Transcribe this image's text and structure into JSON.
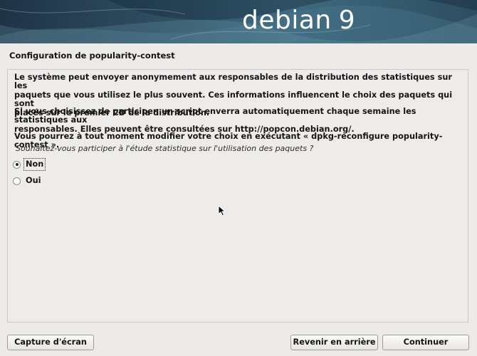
{
  "banner": {
    "brand_text": "debian",
    "brand_version": "9"
  },
  "page": {
    "title": "Configuration de popularity-contest"
  },
  "content": {
    "paragraph1_lines": [
      "Le système peut envoyer anonymement aux responsables de la distribution des statistiques sur les",
      "paquets que vous utilisez le plus souvent. Ces informations influencent le choix des paquets qui sont",
      "placés sur le premier CD de la distribution."
    ],
    "paragraph2_lines": [
      "Si vous choisissez de participer, un script enverra automatiquement chaque semaine les statistiques aux",
      "responsables. Elles peuvent être consultées sur http://popcon.debian.org/."
    ],
    "paragraph3_lines": [
      "Vous pourrez à tout moment modifier votre choix en exécutant « dpkg-reconfigure popularity-contest »."
    ],
    "question": "Souhaitez-vous participer à l'étude statistique sur l'utilisation des paquets ?",
    "options": [
      {
        "label": "Non",
        "selected": true
      },
      {
        "label": "Oui",
        "selected": false
      }
    ]
  },
  "buttons": {
    "screenshot": "Capture d'écran",
    "back": "Revenir en arrière",
    "continue": "Continuer"
  },
  "icons": {
    "pointer": "mouse-pointer-icon",
    "radio": "radio-button-icon"
  },
  "colors": {
    "banner_dark": "#1f3344",
    "banner_mid": "#3f6a80",
    "background": "#ecebe8",
    "text": "#151515"
  }
}
